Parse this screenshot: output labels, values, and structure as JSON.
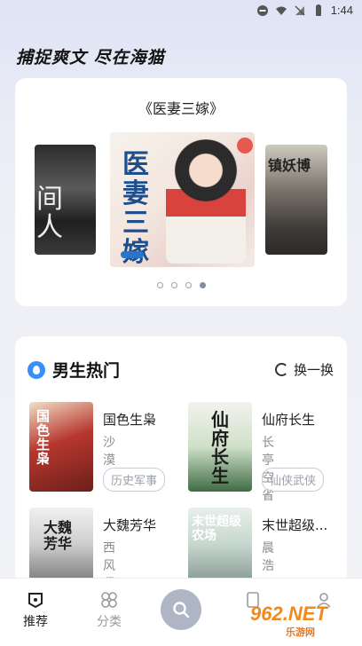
{
  "status_bar": {
    "time": "1:44"
  },
  "slogan": "捕捉爽文 尽在海猫",
  "banner": {
    "title": "《医妻三嫁》",
    "left_cover_text": "间 人",
    "main_cover_text": "医妻三嫁",
    "right_cover_text": "镇妖博",
    "dots": [
      false,
      false,
      false,
      true
    ]
  },
  "hot_section": {
    "title": "男生热门",
    "refresh_label": "换一换",
    "books": [
      {
        "name": "国色生枭",
        "author": "沙漠",
        "tag": "历史军事",
        "cover_text": "国色生枭"
      },
      {
        "name": "仙府长生",
        "author": "长亭空省",
        "tag": "仙侠武侠",
        "cover_text": "仙府长生"
      },
      {
        "name": "大魏芳华",
        "author": "西风紧",
        "tag": "",
        "cover_text": "大魏芳华"
      },
      {
        "name": "末世超级...",
        "author": "晨浩",
        "tag": "",
        "cover_text": "末世超级农场"
      }
    ]
  },
  "bottom_nav": {
    "items": [
      {
        "label": "推荐",
        "icon": "recommend-icon",
        "active": true
      },
      {
        "label": "分类",
        "icon": "category-icon",
        "active": false
      },
      {
        "label": "",
        "icon": "search-icon",
        "active": false
      },
      {
        "label": "",
        "icon": "bookshelf-icon",
        "active": false
      },
      {
        "label": "",
        "icon": "profile-icon",
        "active": false
      }
    ]
  },
  "watermark": {
    "brand": "962.NET",
    "sub": "乐游网"
  },
  "colors": {
    "accent": "#3a8ff6",
    "search_fab": "#aeb6c6",
    "active_dot": "#7f8da6"
  }
}
